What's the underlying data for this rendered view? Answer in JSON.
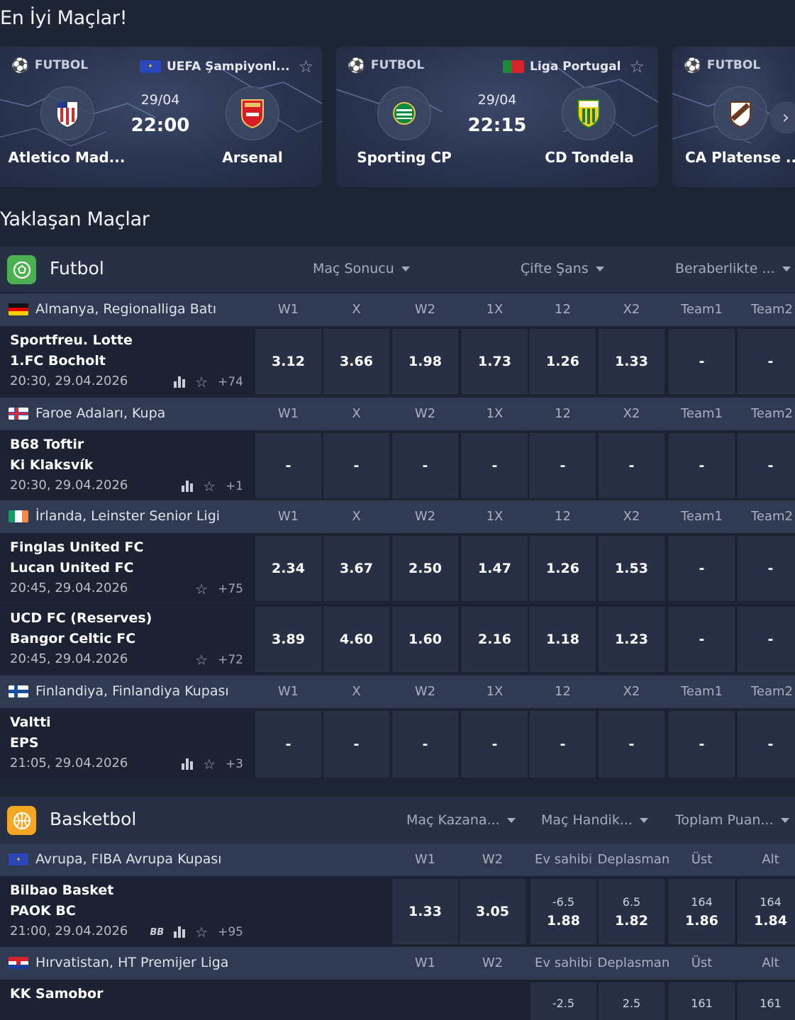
{
  "headings": {
    "top": "En İyi Maçlar!",
    "upcoming": "Yaklaşan Maçlar"
  },
  "featured": [
    {
      "sport": "FUTBOL",
      "league": "UEFA Şampiyonl...",
      "date": "29/04",
      "time": "22:00",
      "home": "Atletico Mad...",
      "away": "Arsenal"
    },
    {
      "sport": "FUTBOL",
      "league": "Liga Portugal",
      "date": "29/04",
      "time": "22:15",
      "home": "Sporting CP",
      "away": "CD Tondela"
    },
    {
      "sport": "FUTBOL",
      "home": "CA Platense ..."
    }
  ],
  "football": {
    "name": "Futbol",
    "markets": [
      "Maç Sonucu",
      "Çifte Şans",
      "Beraberlikte ..."
    ],
    "columns": [
      "W1",
      "X",
      "W2",
      "1X",
      "12",
      "X2",
      "Team1",
      "Team2"
    ],
    "leagues": [
      {
        "name": "Almanya, Regionalliga Batı",
        "matches": [
          {
            "home": "Sportfreu. Lotte",
            "away": "1.FC Bocholt",
            "time": "20:30, 29.04.2026",
            "more": "+74",
            "stats": true,
            "odds": [
              "3.12",
              "3.66",
              "1.98",
              "1.73",
              "1.26",
              "1.33",
              "-",
              "-"
            ]
          }
        ]
      },
      {
        "name": "Faroe Adaları, Kupa",
        "matches": [
          {
            "home": "B68 Toftir",
            "away": "Ki Klaksvík",
            "time": "20:30, 29.04.2026",
            "more": "+1",
            "stats": true,
            "odds": [
              "-",
              "-",
              "-",
              "-",
              "-",
              "-",
              "-",
              "-"
            ]
          }
        ]
      },
      {
        "name": "İrlanda, Leinster Senior Ligi",
        "matches": [
          {
            "home": "Finglas United FC",
            "away": "Lucan United FC",
            "time": "20:45, 29.04.2026",
            "more": "+75",
            "stats": false,
            "odds": [
              "2.34",
              "3.67",
              "2.50",
              "1.47",
              "1.26",
              "1.53",
              "-",
              "-"
            ]
          },
          {
            "home": "UCD FC (Reserves)",
            "away": "Bangor Celtic FC",
            "time": "20:45, 29.04.2026",
            "more": "+72",
            "stats": false,
            "odds": [
              "3.89",
              "4.60",
              "1.60",
              "2.16",
              "1.18",
              "1.23",
              "-",
              "-"
            ]
          }
        ]
      },
      {
        "name": "Finlandiya, Finlandiya Kupası",
        "matches": [
          {
            "home": "Valtti",
            "away": "EPS",
            "time": "21:05, 29.04.2026",
            "more": "+3",
            "stats": true,
            "odds": [
              "-",
              "-",
              "-",
              "-",
              "-",
              "-",
              "-",
              "-"
            ]
          }
        ]
      }
    ]
  },
  "basketball": {
    "name": "Basketbol",
    "markets": [
      "Maç Kazana...",
      "Maç Handik...",
      "Toplam Puan..."
    ],
    "columns": [
      "W1",
      "W2",
      "Ev sahibi",
      "Deplasman",
      "Üst",
      "Alt"
    ],
    "leagues": [
      {
        "name": "Avrupa, FIBA Avrupa Kupası",
        "matches": [
          {
            "home": "Bilbao Basket",
            "away": "PAOK BC",
            "time": "21:00, 29.04.2026",
            "more": "+95",
            "bb": "BB",
            "odds": [
              {
                "v": "1.33"
              },
              {
                "v": "3.05"
              },
              {
                "s": "-6.5",
                "v": "1.88"
              },
              {
                "s": "6.5",
                "v": "1.82"
              },
              {
                "s": "164",
                "v": "1.86"
              },
              {
                "s": "164",
                "v": "1.84"
              }
            ]
          }
        ]
      },
      {
        "name": "Hırvatistan, HT Premijer Liga",
        "matches": [
          {
            "home": "KK Samobor",
            "odds": [
              {
                "s": "-2.5"
              },
              {
                "s": "2.5"
              },
              {
                "s": "161"
              },
              {
                "s": "161"
              }
            ]
          }
        ]
      }
    ]
  },
  "colors": {
    "bg": "#1e2535",
    "header": "#273044",
    "league": "#303a52",
    "odd": "#273044",
    "football_icon": "#4caf50",
    "basket_icon": "#f5a623"
  }
}
